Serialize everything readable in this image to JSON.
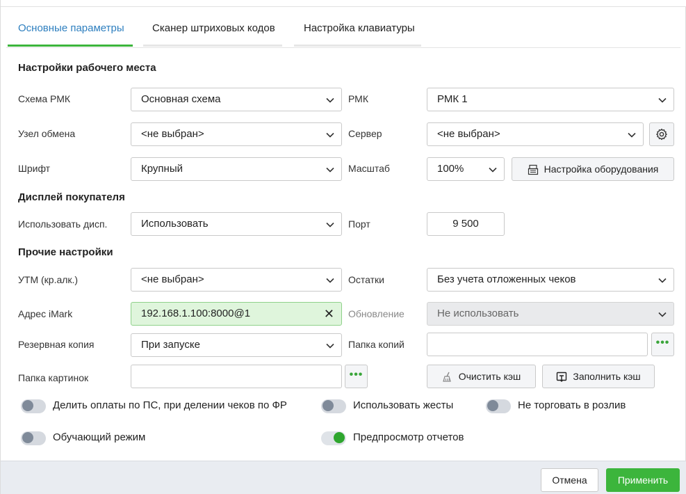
{
  "tabs": [
    {
      "label": "Основные параметры",
      "active": true
    },
    {
      "label": "Сканер штриховых кодов",
      "active": false
    },
    {
      "label": "Настройка клавиатуры",
      "active": false
    }
  ],
  "colors": {
    "accent": "#2e7fbf",
    "active_underline": "#3cb53c",
    "apply": "#3cb53c",
    "toggle_on": "#2ea62e"
  },
  "workplace": {
    "title": "Настройки рабочего места",
    "scheme_label": "Схема РМК",
    "scheme_value": "Основная схема",
    "rmk_label": "РМК",
    "rmk_value": "РМК 1",
    "node_label": "Узел обмена",
    "node_value": "<не выбран>",
    "server_label": "Сервер",
    "server_value": "<не выбран>",
    "font_label": "Шрифт",
    "font_value": "Крупный",
    "scale_label": "Масштаб",
    "scale_value": "100%",
    "equipment_button": "Настройка оборудования"
  },
  "display": {
    "title": "Дисплей покупателя",
    "use_label": "Использовать дисп.",
    "use_value": "Использовать",
    "port_label": "Порт",
    "port_value": "9 500"
  },
  "other": {
    "title": "Прочие настройки",
    "utm_label": "УТМ (кр.алк.)",
    "utm_value": "<не выбран>",
    "stock_label": "Остатки",
    "stock_value": "Без учета отложенных чеков",
    "imark_label": "Адрес iMark",
    "imark_value": "192.168.1.100:8000@1",
    "update_label": "Обновление",
    "update_value": "Не использовать",
    "backup_label": "Резервная копия",
    "backup_value": "При запуске",
    "backup_folder_label": "Папка копий",
    "backup_folder_value": "",
    "images_folder_label": "Папка картинок",
    "images_folder_value": "",
    "clear_cache_button": "Очистить кэш",
    "fill_cache_button": "Заполнить кэш",
    "dots": "•••"
  },
  "toggles": [
    {
      "label": "Делить оплаты по ПС, при делении чеков по ФР",
      "on": false
    },
    {
      "label": "Использовать жесты",
      "on": false
    },
    {
      "label": "Не торговать в розлив",
      "on": false
    },
    {
      "label": "Обучающий режим",
      "on": false
    },
    {
      "label": "Предпросмотр отчетов",
      "on": true
    }
  ],
  "footer": {
    "cancel": "Отмена",
    "apply": "Применить"
  }
}
